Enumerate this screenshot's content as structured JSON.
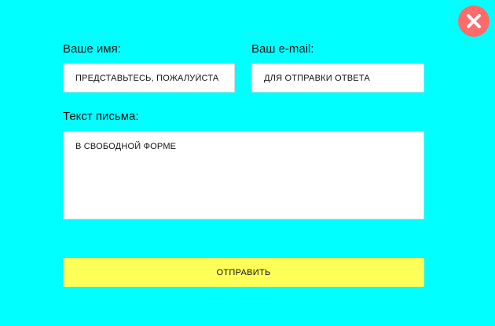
{
  "form": {
    "name_label": "Ваше имя:",
    "name_placeholder": "ПРЕДСТАВЬТЕСЬ, ПОЖАЛУЙСТА",
    "email_label": "Ваш e-mail:",
    "email_placeholder": "ДЛЯ ОТПРАВКИ ОТВЕТА",
    "message_label": "Текст письма:",
    "message_placeholder": "В СВОБОДНОЙ ФОРМЕ",
    "submit_label": "ОТПРАВИТЬ"
  },
  "close": {
    "icon": "close-icon"
  },
  "colors": {
    "background": "#00ffff",
    "close_button": "#ff6b6b",
    "submit_button": "#ffff5a",
    "field_background": "#ffffff"
  }
}
